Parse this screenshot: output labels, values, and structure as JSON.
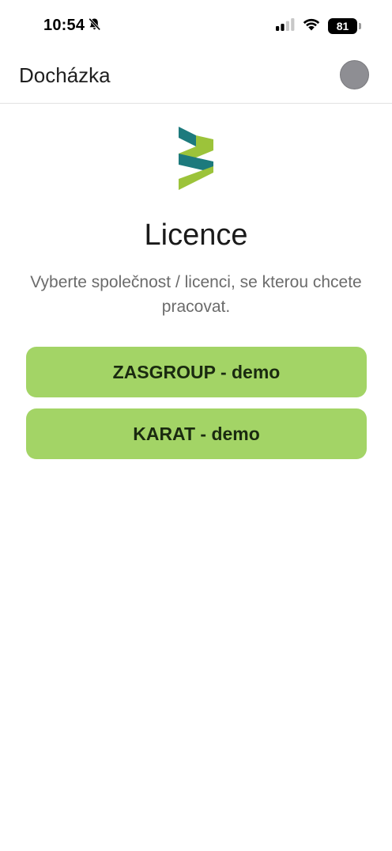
{
  "status_bar": {
    "time": "10:54",
    "battery": "81",
    "icons": [
      "bell-slash-icon",
      "cellular-signal-icon",
      "wifi-icon",
      "battery-icon"
    ]
  },
  "header": {
    "title": "Docházka"
  },
  "main": {
    "logo": "company-logo",
    "title": "Licence",
    "subtitle": "Vyberte společnost / licenci, se kterou chcete pracovat.",
    "licenses": [
      {
        "label": "ZASGROUP - demo"
      },
      {
        "label": "KARAT - demo"
      }
    ]
  },
  "colors": {
    "button_bg": "#a3d466",
    "button_text": "#1a2a10",
    "logo_teal": "#1d7a7d",
    "logo_green": "#9cc33a",
    "avatar": "#8e8e93"
  }
}
